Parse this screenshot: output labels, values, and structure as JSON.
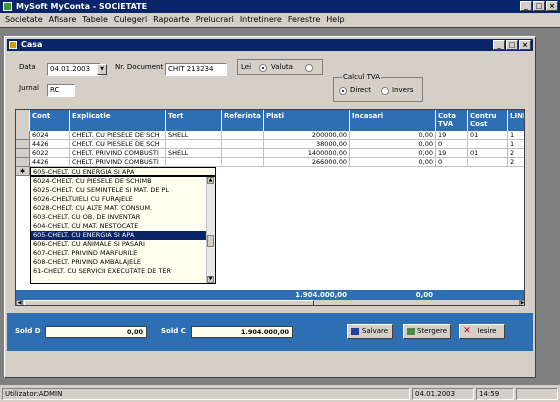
{
  "app": {
    "title": "MySoft MyConta - SOCIETATE"
  },
  "menu": [
    "Societate",
    "Afisare",
    "Tabele",
    "Culegeri",
    "Rapoarte",
    "Prelucrari",
    "Intretinere",
    "Ferestre",
    "Help"
  ],
  "window": {
    "title": "Casa"
  },
  "form": {
    "data_label": "Data",
    "data_value": "04.01.2003",
    "nr_doc_label": "Nr. Document",
    "nr_doc_value": "CHIT 213234",
    "lei_label": "Lei",
    "valuta_label": "Valuta",
    "jurnal_label": "Jurnal",
    "jurnal_value": "RC",
    "tva_group_label": "Calcul TVA",
    "direct_label": "Direct",
    "invers_label": "Invers"
  },
  "grid": {
    "headers": [
      "Cont",
      "Explicatie",
      "Tert",
      "Referinta",
      "Plati",
      "Incasari",
      "Cota TVA",
      "Centru Cost",
      "LINIE"
    ],
    "rows": [
      [
        "6024",
        "CHELT. CU PIESELE DE SCH",
        "SHELL",
        "",
        "200000,00",
        "0,00",
        "19",
        "01",
        "1"
      ],
      [
        "4426",
        "CHELT. CU PIESELE DE SCH",
        "",
        "",
        "38000,00",
        "0,00",
        "0",
        "",
        "1"
      ],
      [
        "6022",
        "CHELT. PRIVIND COMBUSTI",
        "SHELL",
        "",
        "1400000,00",
        "0,00",
        "19",
        "01",
        "2"
      ],
      [
        "4426",
        "CHELT. PRIVIND COMBUSTI",
        "",
        "",
        "266000,00",
        "0,00",
        "0",
        "",
        "2"
      ]
    ],
    "edit_row_value": "605-CHELT. CU ENERGIA SI APA",
    "total_plati": "1.904.000,00",
    "total_incasari": "0,00"
  },
  "dropdown": {
    "items": [
      "6024-CHELT. CU PIESELE DE SCHIMB",
      "6025-CHELT. CU SEMINTELE SI MAT. DE PL",
      "6026-CHELTUIELI CU FURAJELE",
      "6028-CHELT. CU ALTE MAT. CONSUM.",
      "603-CHELT. CU OB. DE INVENTAR",
      "604-CHELT. CU MAT. NESTOCATE",
      "605-CHELT. CU ENERGIA SI APA",
      "606-CHELT. CU ANIMALE SI PASARI",
      "607-CHELT. PRIVIND MARFURILE",
      "608-CHELT. PRIVIND AMBALAJELE",
      "61-CHELT. CU SERVICII EXECUTATE DE TER"
    ],
    "selected_index": 6
  },
  "footer": {
    "sold_d_label": "Sold D",
    "sold_d_value": "0,00",
    "sold_c_label": "Sold C",
    "sold_c_value": "1.904.000,00",
    "salvare_label": "Salvare",
    "stergere_label": "Stergere",
    "iesire_label": "Iesire"
  },
  "status": {
    "user": "Utilizator:ADMIN",
    "date": "04.01.2003",
    "time": "14:59"
  },
  "colors": {
    "titlebar": "#0a246a",
    "grid_header": "#2e6fb3",
    "face": "#d4d0c8",
    "selection": "#0a246a"
  }
}
